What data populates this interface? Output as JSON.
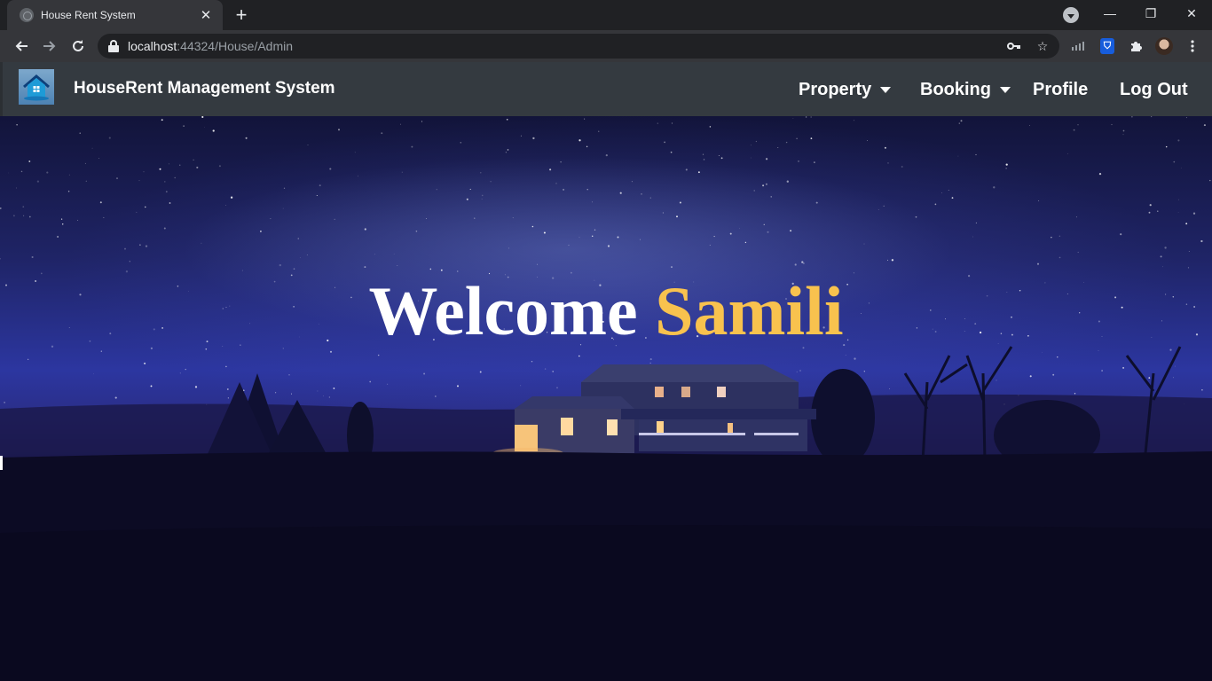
{
  "browser": {
    "tab_title": "House Rent System",
    "new_tab_label": "+",
    "url_host": "localhost",
    "url_rest": ":44324/House/Admin",
    "window_controls": {
      "minimize": "—",
      "restore": "❐",
      "close": "✕"
    }
  },
  "navbar": {
    "brand": "HouseRent Management System",
    "items": [
      {
        "label": "Property",
        "dropdown": true
      },
      {
        "label": "Booking",
        "dropdown": true
      },
      {
        "label": "Profile",
        "dropdown": false
      },
      {
        "label": "Log Out",
        "dropdown": false
      }
    ]
  },
  "hero": {
    "greeting": "Welcome",
    "username": "Samili",
    "accent_color": "#f8c24e"
  },
  "icons": [
    "globe-icon",
    "close-icon",
    "plus-icon",
    "back-arrow-icon",
    "forward-arrow-icon",
    "reload-icon",
    "lock-icon",
    "key-icon",
    "star-icon",
    "bitwarden-icon",
    "puzzle-icon",
    "avatar",
    "kebab-menu-icon",
    "house-logo-icon",
    "caret-down-icon"
  ]
}
